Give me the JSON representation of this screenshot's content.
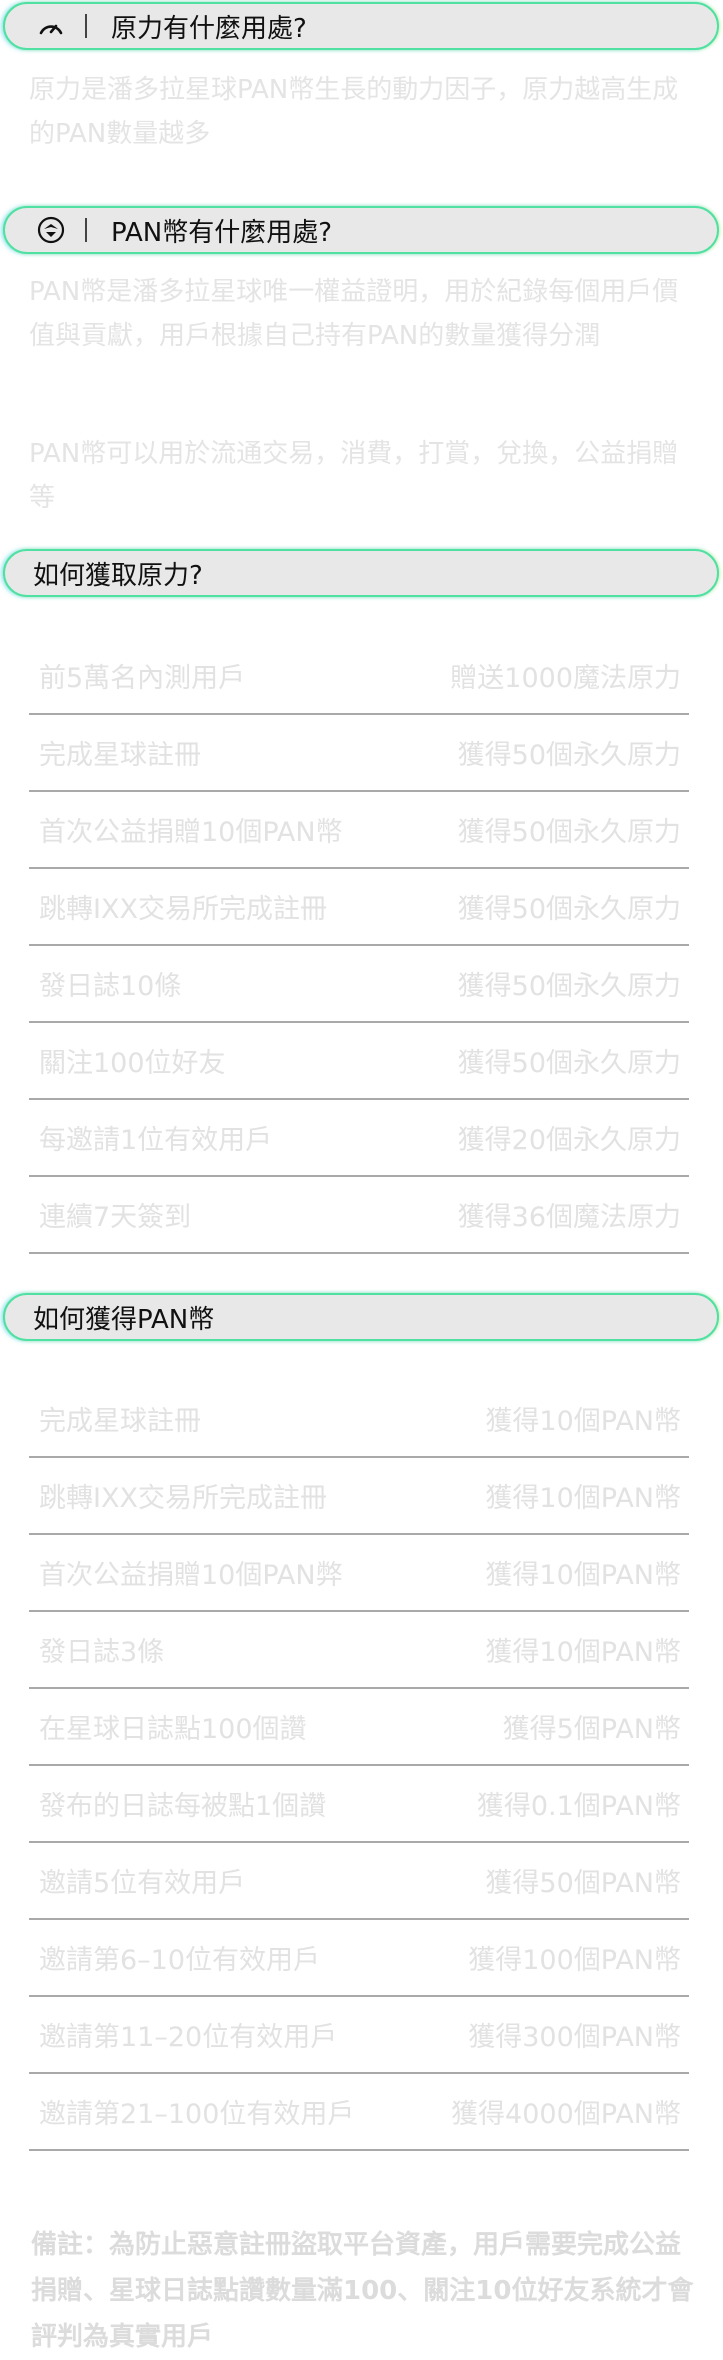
{
  "sections": {
    "force_use": {
      "title": "原力有什麼用處?",
      "paragraph": "原力是潘多拉星球PAN幣生長的動力因子，原力越高生成的PAN數量越多"
    },
    "pan_use": {
      "title": "PAN幣有什麼用處?",
      "paragraph1": "PAN幣是潘多拉星球唯一權益證明，用於紀錄每個用戶價值與貢獻，用戶根據自己持有PAN的數量獲得分潤",
      "paragraph2": "PAN幣可以用於流通交易，消費，打賞，兌換，公益捐贈等"
    },
    "get_force": {
      "title": "如何獲取原力?",
      "rows": [
        {
          "label": "前5萬名內測用戶",
          "reward": "贈送1000魔法原力"
        },
        {
          "label": "完成星球註冊",
          "reward": "獲得50個永久原力"
        },
        {
          "label": "首次公益捐贈10個PAN幣",
          "reward": "獲得50個永久原力"
        },
        {
          "label": "跳轉IXX交易所完成註冊",
          "reward": "獲得50個永久原力"
        },
        {
          "label": "發日誌10條",
          "reward": "獲得50個永久原力"
        },
        {
          "label": "關注100位好友",
          "reward": "獲得50個永久原力"
        },
        {
          "label": "每邀請1位有效用戶",
          "reward": "獲得20個永久原力"
        },
        {
          "label": "連續7天簽到",
          "reward": "獲得36個魔法原力"
        }
      ]
    },
    "get_pan": {
      "title": "如何獲得PAN幣",
      "rows": [
        {
          "label": "完成星球註冊",
          "reward": "獲得10個PAN幣"
        },
        {
          "label": "跳轉IXX交易所完成註冊",
          "reward": "獲得10個PAN幣"
        },
        {
          "label": "首次公益捐贈10個PAN弊",
          "reward": "獲得10個PAN幣"
        },
        {
          "label": "發日誌3條",
          "reward": "獲得10個PAN幣"
        },
        {
          "label": "在星球日誌點100個讚",
          "reward": "獲得5個PAN幣"
        },
        {
          "label": "發布的日誌每被點1個讚",
          "reward": "獲得0.1個PAN幣"
        },
        {
          "label": "邀請5位有效用戶",
          "reward": "獲得50個PAN幣"
        },
        {
          "label": "邀請第6–10位有效用戶",
          "reward": "獲得100個PAN幣"
        },
        {
          "label": "邀請第11–20位有效用戶",
          "reward": "獲得300個PAN幣"
        },
        {
          "label": "邀請第21–100位有效用戶",
          "reward": "獲得4000個PAN幣"
        }
      ]
    }
  },
  "note": "備註：為防止惡意註冊盜取平台資產，用戶需要完成公益捐贈、星球日誌點讚數量滿100、關注10位好友系統才會評判為真實用戶",
  "colors": {
    "pill_border": "#4fe0a2",
    "pill_bg": "#e8e8e8",
    "faded_text": "#e4e4e4",
    "divider": "#a9a9a9"
  },
  "icons": [
    "gauge-icon",
    "pan-coin-icon"
  ]
}
